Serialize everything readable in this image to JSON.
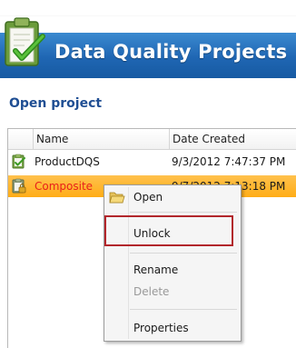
{
  "app": {
    "title": "Data Quality Projects"
  },
  "section": {
    "title": "Open project"
  },
  "table": {
    "columns": [
      "Name",
      "Date Created"
    ],
    "rows": [
      {
        "name": "ProductDQS",
        "date": "9/3/2012 7:47:37 PM",
        "selected": false
      },
      {
        "name": "Composite",
        "date": "9/7/2012 7:13:18 PM",
        "selected": true
      }
    ]
  },
  "context_menu": {
    "items": [
      {
        "label": "Open",
        "enabled": true
      },
      {
        "label": "Unlock",
        "enabled": true
      },
      {
        "label": "Rename",
        "enabled": true
      },
      {
        "label": "Delete",
        "enabled": false
      },
      {
        "label": "Properties",
        "enabled": true
      }
    ]
  },
  "colors": {
    "banner": "#1f66b3",
    "selected_row": "#ffad17",
    "selected_text": "#e8211b",
    "section_title": "#1f4e93",
    "highlight": "#b2262b"
  },
  "icons": {
    "logo": "clipboard-check-icon",
    "row_icon": "project-icon",
    "locked_row_icon": "locked-project-icon",
    "open": "folder-open-icon"
  }
}
